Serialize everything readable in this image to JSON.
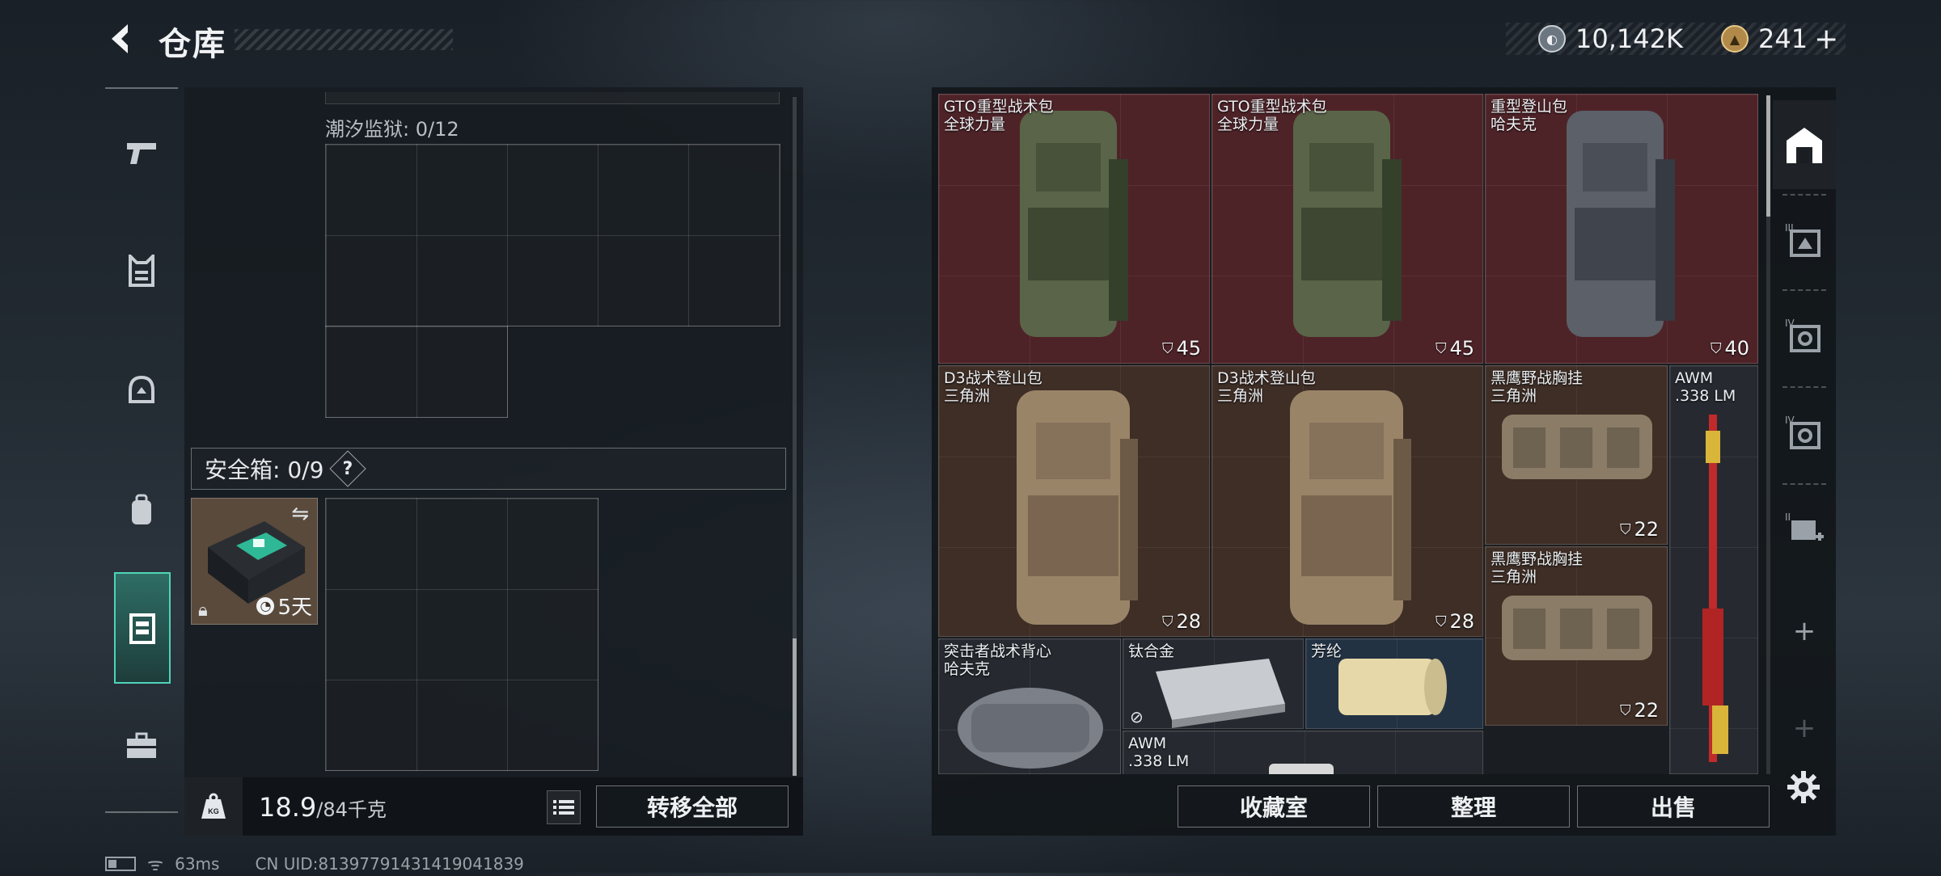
{
  "header": {
    "title": "仓库"
  },
  "currency": [
    {
      "icon": "silver-coin-icon",
      "value": "10,142K"
    },
    {
      "icon": "gold-triangle-coin-icon",
      "value": "241"
    }
  ],
  "nav": [
    {
      "name": "nav-weapons",
      "icon": "pistol-icon"
    },
    {
      "name": "nav-armor",
      "icon": "armor-vest-icon"
    },
    {
      "name": "nav-helmet",
      "icon": "helmet-icon"
    },
    {
      "name": "nav-backpack",
      "icon": "backpack-icon"
    },
    {
      "name": "nav-container",
      "icon": "container-icon",
      "active": true
    },
    {
      "name": "nav-briefcase",
      "icon": "briefcase-icon"
    }
  ],
  "left": {
    "tide_prison_label": "潮汐监狱: 0/12",
    "safebox_label": "安全箱: 0/9",
    "safebox_help": "?",
    "safebox_item_timer": "5天",
    "weight_value": "18.9",
    "weight_max": "/84千克",
    "transfer_all": "转移全部"
  },
  "items": [
    {
      "name": "GTO重型战术包",
      "sub": "全球力量",
      "count": "45",
      "color": "red"
    },
    {
      "name": "GTO重型战术包",
      "sub": "全球力量",
      "count": "45",
      "color": "red"
    },
    {
      "name": "重型登山包",
      "sub": "哈夫克",
      "count": "40",
      "color": "red"
    },
    {
      "name": "D3战术登山包",
      "sub": "三角洲",
      "count": "28",
      "color": "brown"
    },
    {
      "name": "D3战术登山包",
      "sub": "三角洲",
      "count": "28",
      "color": "brown"
    },
    {
      "name": "黑鹰野战胸挂",
      "sub": "三角洲",
      "count": "22",
      "color": "brown"
    },
    {
      "name": "黑鹰野战胸挂",
      "sub": "三角洲",
      "count": "22",
      "color": "brown"
    },
    {
      "name": "AWM",
      "sub": ".338 LM",
      "count": "",
      "color": "gray"
    },
    {
      "name": "突击者战术背心",
      "sub": "哈夫克",
      "count": "",
      "color": "gray"
    },
    {
      "name": "钛合金",
      "sub": "",
      "count": "",
      "color": "gray"
    },
    {
      "name": "芳纶",
      "sub": "",
      "count": "",
      "color": "blue"
    },
    {
      "name": "AWM",
      "sub": ".338 LM",
      "count": "",
      "color": "gray"
    }
  ],
  "bottom_buttons": {
    "collection": "收藏室",
    "sort": "整理",
    "sell": "出售"
  },
  "status": {
    "ping": "63ms",
    "uid": "CN UID:8139779143141904183​9"
  },
  "colors": {
    "accent": "#4fd3b8",
    "red_item": "#4e2328",
    "brown_item": "#3e2e26",
    "blue_item": "#233243"
  }
}
